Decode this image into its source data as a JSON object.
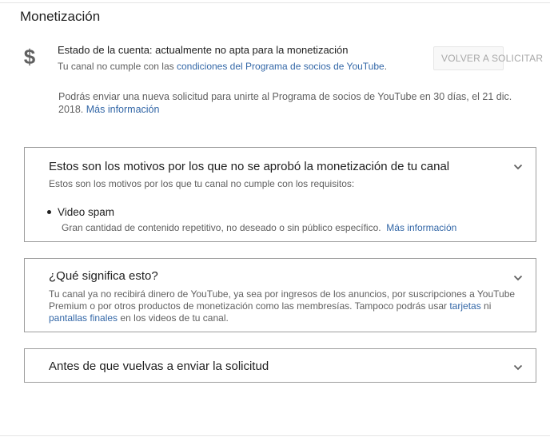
{
  "page": {
    "title": "Monetización"
  },
  "status": {
    "title": "Estado de la cuenta: actualmente no apta para la monetización",
    "desc_prefix": "Tu canal no cumple con las ",
    "desc_link": "condiciones del Programa de socios de YouTube",
    "desc_suffix": ".",
    "icon": "dollar-icon",
    "icon_glyph": "$",
    "reapply_label": "VOLVER A SOLICITAR"
  },
  "notice": {
    "text": "Podrás enviar una nueva solicitud para unirte al Programa de socios de YouTube en 30 días, el 21 dic. 2018. ",
    "link": "Más información"
  },
  "sections": {
    "reasons": {
      "title": "Estos son los motivos por los que no se aprobó la monetización de tu canal",
      "desc": "Estos son los motivos por los que tu canal no cumple con los requisitos:",
      "item_title": "Video spam",
      "item_desc": "Gran cantidad de contenido repetitivo, no deseado o sin público específico.",
      "item_link": "Más información"
    },
    "meaning": {
      "title": "¿Qué significa esto?",
      "text_part1": "Tu canal ya no recibirá dinero de YouTube, ya sea por ingresos de los anuncios, por suscripciones a YouTube Premium o por otros productos de monetización como las membresías. Tampoco podrás usar ",
      "link_cards": "tarjetas",
      "text_part2": " ni ",
      "link_endscreens": "pantallas finales",
      "text_part3": " en los videos de tu canal."
    },
    "before": {
      "title": "Antes de que vuelvas a enviar la solicitud"
    }
  },
  "colors": {
    "link": "#3367a7",
    "secondary_text": "#606060",
    "card_border": "#9e9e9e"
  }
}
